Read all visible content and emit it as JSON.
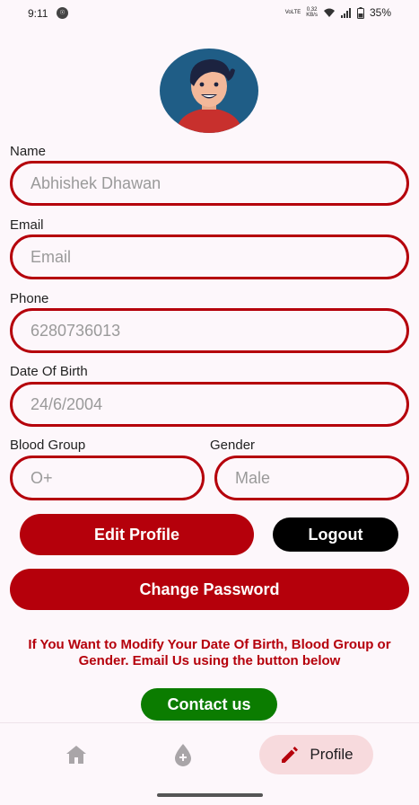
{
  "status": {
    "time": "9:11",
    "app_icon": "☉",
    "volte_top": "VoLTE",
    "network_speed_top": "0.32",
    "network_speed_bottom": "KB/s",
    "battery": "35%"
  },
  "profile": {
    "name_label": "Name",
    "name_value": "Abhishek Dhawan",
    "email_label": "Email",
    "email_placeholder": "Email",
    "phone_label": "Phone",
    "phone_value": "6280736013",
    "dob_label": "Date Of Birth",
    "dob_value": "24/6/2004",
    "blood_label": "Blood Group",
    "blood_value": "O+",
    "gender_label": "Gender",
    "gender_value": "Male"
  },
  "actions": {
    "edit_profile": "Edit Profile",
    "logout": "Logout",
    "change_password": "Change Password",
    "notice": "If You Want to Modify Your Date Of Birth, Blood Group or Gender. Email Us using the button below",
    "contact_us": "Contact us"
  },
  "nav": {
    "items": [
      {
        "icon": "home-icon"
      },
      {
        "icon": "donate-icon"
      },
      {
        "icon": "pencil-icon",
        "label": "Profile"
      }
    ]
  },
  "colors": {
    "primary_red": "#b5000b",
    "black": "#000000",
    "green": "#0b7c00",
    "background": "#fdf7fb",
    "nav_active_bg": "#f7dadd"
  }
}
